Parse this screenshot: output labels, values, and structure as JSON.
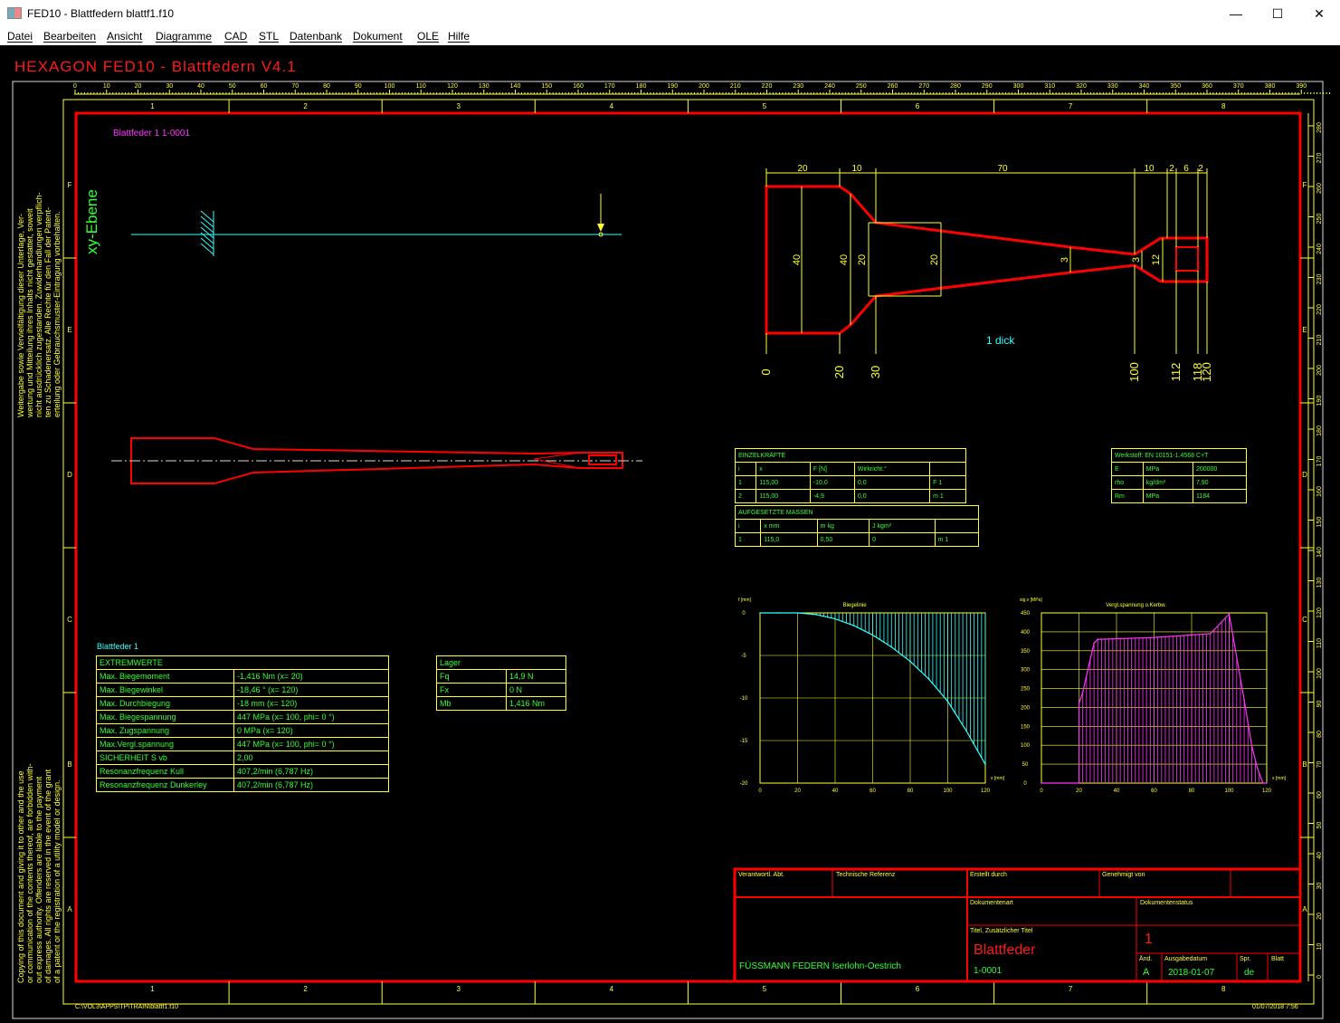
{
  "window": {
    "title": "FED10 - Blattfedern   blattf1.f10",
    "minimize_glyph": "—",
    "maximize_glyph": "☐",
    "close_glyph": "✕"
  },
  "menu": [
    "Datei",
    "Bearbeiten",
    "Ansicht",
    "Diagramme",
    "CAD",
    "STL",
    "Datenbank",
    "Dokument",
    "OLE",
    "Hilfe"
  ],
  "drawing": {
    "header": "HEXAGON   FED10 - Blattfedern  V4.1",
    "spring_title": "Blattfeder  1  1-0001",
    "plane_label": "xy-Ebene",
    "thickness_label": "1 dick",
    "ruler_top": [
      "0",
      "10",
      "20",
      "30",
      "40",
      "50",
      "60",
      "70",
      "80",
      "90",
      "100",
      "110",
      "120",
      "130",
      "140",
      "150",
      "160",
      "170",
      "180",
      "190",
      "200",
      "210",
      "220",
      "230",
      "240",
      "250",
      "260",
      "270",
      "280",
      "290",
      "300",
      "310",
      "320",
      "330",
      "340",
      "350",
      "360",
      "370",
      "380",
      "390"
    ],
    "ruler_right": [
      "0",
      "10",
      "20",
      "30",
      "40",
      "50",
      "60",
      "70",
      "80",
      "90",
      "100",
      "110",
      "120",
      "130",
      "140",
      "150",
      "160",
      "170",
      "180",
      "190",
      "200",
      "210",
      "220",
      "230",
      "240",
      "250",
      "260",
      "270",
      "280"
    ],
    "zone_numbers": [
      "1",
      "2",
      "3",
      "4",
      "5",
      "6",
      "7",
      "8"
    ],
    "zone_letters": [
      "F",
      "E",
      "D",
      "C",
      "B",
      "A"
    ],
    "dims_top": [
      "20",
      "10",
      "70",
      "10",
      "2",
      "6",
      "2"
    ],
    "dims_vertical": [
      "40",
      "40",
      "20",
      "20",
      "3",
      "3",
      "12"
    ],
    "dims_bottom": [
      "0",
      "20",
      "30",
      "100",
      "112",
      "118",
      "120"
    ],
    "copyright_de": "Weitergabe sowie Vervielfältigung dieser Unterlage, Ver-\nwertung und Mitteilung ihres Inhalts nicht gestattet, soweit\nnicht ausdrücklich zugestanden. Zuwiderhandlungen verpflich-\nten zu Schadenersatz. Alle Rechte für den Fall der Patent-\nerteilung oder Gebrauchsmuster-Eintragung vorbehalten.",
    "copyright_en": "Copying of this document and giving it to other and the use\nor communication of the contents thereof, are forbidden with-\nout express authority. Offenders are liable to the payment\nof damages. All rights are reserved in the event of the grant\nof a patent or the registration of a utility model or design.",
    "footer_path": "C:\\VOL3\\APPS\\TP\\TRAIN\\blattf1.f10",
    "footer_date": "01/07/2018 7:56"
  },
  "einzelkraefte": {
    "title": "EINZELKRÄFTE",
    "headers": [
      "i",
      "x",
      "F [N]",
      "Wirkricht.°",
      ""
    ],
    "rows": [
      [
        "1",
        "115,00",
        "-10,0",
        "0,0",
        "F 1"
      ],
      [
        "2",
        "115,00",
        "-4,9",
        "0,0",
        "m 1"
      ]
    ]
  },
  "werkstoff": {
    "title": "Werkstoff: EN 10151-1.4568 C+T",
    "rows": [
      [
        "E",
        "MPa",
        "200000"
      ],
      [
        "rho",
        "kg/dm³",
        "7,90"
      ],
      [
        "Rm",
        "MPa",
        "1184"
      ]
    ]
  },
  "massen": {
    "title": "AUFGESETZTE MASSEN",
    "headers": [
      "i",
      "x mm",
      "m kg",
      "J kgm²",
      ""
    ],
    "rows": [
      [
        "1",
        "115,0",
        "0,50",
        "0",
        "m 1"
      ]
    ]
  },
  "results": {
    "caption": "Blattfeder 1",
    "title": "EXTREMWERTE",
    "rows": [
      [
        "Max. Biegemoment",
        "-1,416 Nm  (x= 20)"
      ],
      [
        "Max. Biegewinkel",
        "-18,46 °  (x= 120)"
      ],
      [
        "Max. Durchbiegung",
        "-18 mm  (x= 120)"
      ],
      [
        "Max. Biegespannung",
        "  447 MPa  (x= 100, phi= 0 °)"
      ],
      [
        "Max. Zugspannung",
        "    0 MPa  (x= 120)"
      ],
      [
        "Max.Vergl.spannung",
        "  447 MPa  (x= 100, phi= 0 °)"
      ],
      [
        "SICHERHEIT S vb",
        "    2,00"
      ],
      [
        "Resonanzfrequenz Kull",
        "407,2/min  (6,787 Hz)"
      ],
      [
        "Resonanzfrequenz Dunkerley",
        "407,2/min  (6,787 Hz)"
      ]
    ]
  },
  "lager": {
    "title": "Lager",
    "rows": [
      [
        "Fq",
        "14,9 N"
      ],
      [
        "Fx",
        "0 N"
      ],
      [
        "Mb",
        "1,416 Nm"
      ]
    ]
  },
  "titleblock": {
    "verantw": "Verantwortl. Abt.",
    "techref": "Technische Referenz",
    "erstellt": "Erstellt durch",
    "genehmigt": "Genehmigt von",
    "dokart": "Dokumentenart",
    "dokstatus": "Dokumentenstatus",
    "titel_label": "Titel, Zusätzlicher Titel",
    "titel": "Blattfeder",
    "nummer": "1-0001",
    "blatt_value": "1",
    "company": "FÜSSMANN FEDERN  Iserlohn-Oestrich",
    "aend_label": "Änd.",
    "aend": "A",
    "ausgabe_label": "Ausgabedatum",
    "ausgabe": "2018-01-07",
    "spr_label": "Spr.",
    "spr": "de",
    "blatt_label": "Blatt"
  },
  "colors": {
    "frame": "#ff0000",
    "grid": "#ffff33",
    "text": "#33ff33",
    "magenta": "#ff33ff",
    "cyan": "#33ffff"
  },
  "chart_data": [
    {
      "type": "area",
      "title": "Biegelinie",
      "ylabel": "f [mm]",
      "xlabel": "x [mm]",
      "x": [
        0,
        10,
        20,
        30,
        40,
        50,
        60,
        70,
        80,
        90,
        100,
        110,
        120
      ],
      "y": [
        0,
        0,
        0,
        -0.2,
        -0.7,
        -1.5,
        -2.6,
        -4.0,
        -5.7,
        -7.8,
        -10.4,
        -13.9,
        -17.8
      ],
      "xticks": [
        "0",
        "20",
        "40",
        "60",
        "80",
        "100",
        "120"
      ],
      "yticks": [
        "0",
        "-5",
        "-10",
        "-15",
        "-20"
      ],
      "xlim": [
        0,
        120
      ],
      "ylim": [
        -20,
        0
      ],
      "grid": true
    },
    {
      "type": "area",
      "title": "Vergl.spannung o.Kerbw.",
      "ylabel": "sig.v [MPa]",
      "xlabel": "x [mm]",
      "x": [
        0,
        20,
        20,
        22,
        28,
        30,
        60,
        90,
        100,
        108,
        112,
        115,
        118,
        120
      ],
      "y": [
        0,
        0,
        210,
        240,
        370,
        380,
        385,
        395,
        447,
        220,
        100,
        40,
        0,
        0
      ],
      "xticks": [
        "0",
        "20",
        "40",
        "60",
        "80",
        "100",
        "120"
      ],
      "yticks": [
        "0",
        "50",
        "100",
        "150",
        "200",
        "250",
        "300",
        "350",
        "400",
        "450"
      ],
      "xlim": [
        0,
        120
      ],
      "ylim": [
        0,
        450
      ],
      "grid": true
    }
  ]
}
